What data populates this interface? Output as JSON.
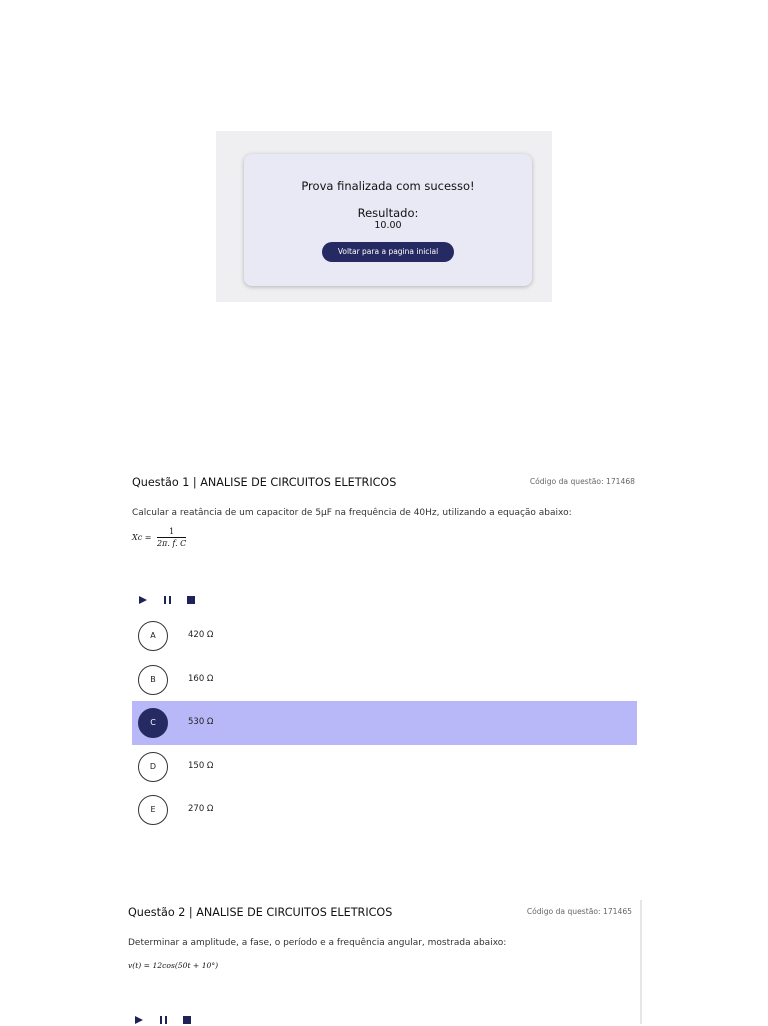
{
  "result": {
    "message": "Prova finalizada com sucesso!",
    "label": "Resultado:",
    "value": "10.00",
    "button_label": "Voltar para a pagina inicial"
  },
  "questions": [
    {
      "title": "Questão 1 | ANALISE DE CIRCUITOS ELETRICOS",
      "code": "Código da questão: 171468",
      "statement": "Calcular a reatância de um capacitor de 5µF na frequência de 40Hz, utilizando a equação abaixo:",
      "formula_lhs": "Xc =",
      "formula_num": "1",
      "formula_den": "2π. f. C",
      "media_controls": [
        "play-icon",
        "pause-icon",
        "stop-icon"
      ],
      "options": [
        {
          "letter": "A",
          "text": "420 Ω"
        },
        {
          "letter": "B",
          "text": "160 Ω"
        },
        {
          "letter": "C",
          "text": "530 Ω"
        },
        {
          "letter": "D",
          "text": "150 Ω"
        },
        {
          "letter": "E",
          "text": "270 Ω"
        }
      ],
      "selected": "C"
    },
    {
      "title": "Questão 2 | ANALISE DE CIRCUITOS ELETRICOS",
      "code": "Código da questão: 171465",
      "statement": "Determinar a amplitude, a fase, o período e a frequência angular, mostrada abaixo:",
      "formula": "v(t) = 12cos(50t + 10°)",
      "media_controls": [
        "play-icon",
        "pause-icon",
        "stop-icon"
      ]
    }
  ],
  "colors": {
    "accent": "#262a63",
    "selected_bg": "#b8b8f8",
    "card_bg": "#e9e9f5",
    "panel_bg": "#efeff2"
  }
}
